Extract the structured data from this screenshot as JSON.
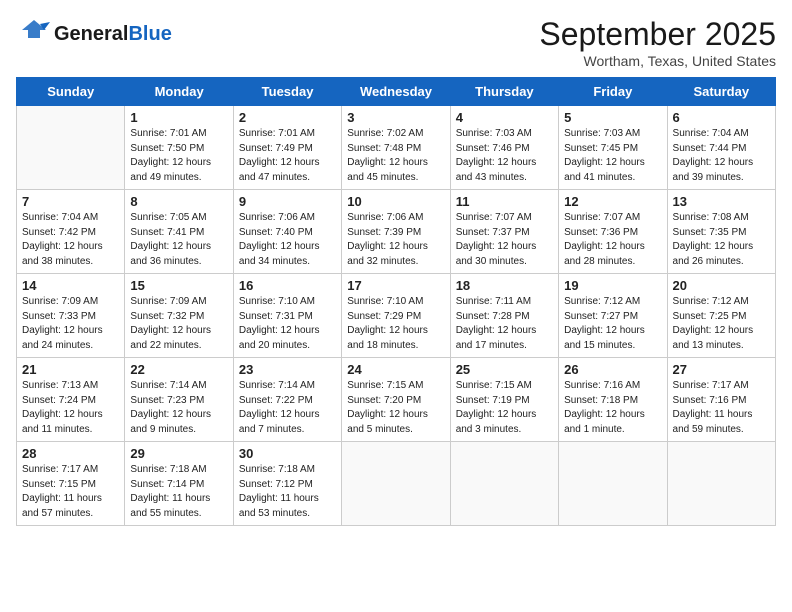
{
  "logo": {
    "general": "General",
    "blue": "Blue"
  },
  "title": "September 2025",
  "location": "Wortham, Texas, United States",
  "days_of_week": [
    "Sunday",
    "Monday",
    "Tuesday",
    "Wednesday",
    "Thursday",
    "Friday",
    "Saturday"
  ],
  "weeks": [
    [
      {
        "day": "",
        "info": ""
      },
      {
        "day": "1",
        "info": "Sunrise: 7:01 AM\nSunset: 7:50 PM\nDaylight: 12 hours\nand 49 minutes."
      },
      {
        "day": "2",
        "info": "Sunrise: 7:01 AM\nSunset: 7:49 PM\nDaylight: 12 hours\nand 47 minutes."
      },
      {
        "day": "3",
        "info": "Sunrise: 7:02 AM\nSunset: 7:48 PM\nDaylight: 12 hours\nand 45 minutes."
      },
      {
        "day": "4",
        "info": "Sunrise: 7:03 AM\nSunset: 7:46 PM\nDaylight: 12 hours\nand 43 minutes."
      },
      {
        "day": "5",
        "info": "Sunrise: 7:03 AM\nSunset: 7:45 PM\nDaylight: 12 hours\nand 41 minutes."
      },
      {
        "day": "6",
        "info": "Sunrise: 7:04 AM\nSunset: 7:44 PM\nDaylight: 12 hours\nand 39 minutes."
      }
    ],
    [
      {
        "day": "7",
        "info": "Sunrise: 7:04 AM\nSunset: 7:42 PM\nDaylight: 12 hours\nand 38 minutes."
      },
      {
        "day": "8",
        "info": "Sunrise: 7:05 AM\nSunset: 7:41 PM\nDaylight: 12 hours\nand 36 minutes."
      },
      {
        "day": "9",
        "info": "Sunrise: 7:06 AM\nSunset: 7:40 PM\nDaylight: 12 hours\nand 34 minutes."
      },
      {
        "day": "10",
        "info": "Sunrise: 7:06 AM\nSunset: 7:39 PM\nDaylight: 12 hours\nand 32 minutes."
      },
      {
        "day": "11",
        "info": "Sunrise: 7:07 AM\nSunset: 7:37 PM\nDaylight: 12 hours\nand 30 minutes."
      },
      {
        "day": "12",
        "info": "Sunrise: 7:07 AM\nSunset: 7:36 PM\nDaylight: 12 hours\nand 28 minutes."
      },
      {
        "day": "13",
        "info": "Sunrise: 7:08 AM\nSunset: 7:35 PM\nDaylight: 12 hours\nand 26 minutes."
      }
    ],
    [
      {
        "day": "14",
        "info": "Sunrise: 7:09 AM\nSunset: 7:33 PM\nDaylight: 12 hours\nand 24 minutes."
      },
      {
        "day": "15",
        "info": "Sunrise: 7:09 AM\nSunset: 7:32 PM\nDaylight: 12 hours\nand 22 minutes."
      },
      {
        "day": "16",
        "info": "Sunrise: 7:10 AM\nSunset: 7:31 PM\nDaylight: 12 hours\nand 20 minutes."
      },
      {
        "day": "17",
        "info": "Sunrise: 7:10 AM\nSunset: 7:29 PM\nDaylight: 12 hours\nand 18 minutes."
      },
      {
        "day": "18",
        "info": "Sunrise: 7:11 AM\nSunset: 7:28 PM\nDaylight: 12 hours\nand 17 minutes."
      },
      {
        "day": "19",
        "info": "Sunrise: 7:12 AM\nSunset: 7:27 PM\nDaylight: 12 hours\nand 15 minutes."
      },
      {
        "day": "20",
        "info": "Sunrise: 7:12 AM\nSunset: 7:25 PM\nDaylight: 12 hours\nand 13 minutes."
      }
    ],
    [
      {
        "day": "21",
        "info": "Sunrise: 7:13 AM\nSunset: 7:24 PM\nDaylight: 12 hours\nand 11 minutes."
      },
      {
        "day": "22",
        "info": "Sunrise: 7:14 AM\nSunset: 7:23 PM\nDaylight: 12 hours\nand 9 minutes."
      },
      {
        "day": "23",
        "info": "Sunrise: 7:14 AM\nSunset: 7:22 PM\nDaylight: 12 hours\nand 7 minutes."
      },
      {
        "day": "24",
        "info": "Sunrise: 7:15 AM\nSunset: 7:20 PM\nDaylight: 12 hours\nand 5 minutes."
      },
      {
        "day": "25",
        "info": "Sunrise: 7:15 AM\nSunset: 7:19 PM\nDaylight: 12 hours\nand 3 minutes."
      },
      {
        "day": "26",
        "info": "Sunrise: 7:16 AM\nSunset: 7:18 PM\nDaylight: 12 hours\nand 1 minute."
      },
      {
        "day": "27",
        "info": "Sunrise: 7:17 AM\nSunset: 7:16 PM\nDaylight: 11 hours\nand 59 minutes."
      }
    ],
    [
      {
        "day": "28",
        "info": "Sunrise: 7:17 AM\nSunset: 7:15 PM\nDaylight: 11 hours\nand 57 minutes."
      },
      {
        "day": "29",
        "info": "Sunrise: 7:18 AM\nSunset: 7:14 PM\nDaylight: 11 hours\nand 55 minutes."
      },
      {
        "day": "30",
        "info": "Sunrise: 7:18 AM\nSunset: 7:12 PM\nDaylight: 11 hours\nand 53 minutes."
      },
      {
        "day": "",
        "info": ""
      },
      {
        "day": "",
        "info": ""
      },
      {
        "day": "",
        "info": ""
      },
      {
        "day": "",
        "info": ""
      }
    ]
  ]
}
